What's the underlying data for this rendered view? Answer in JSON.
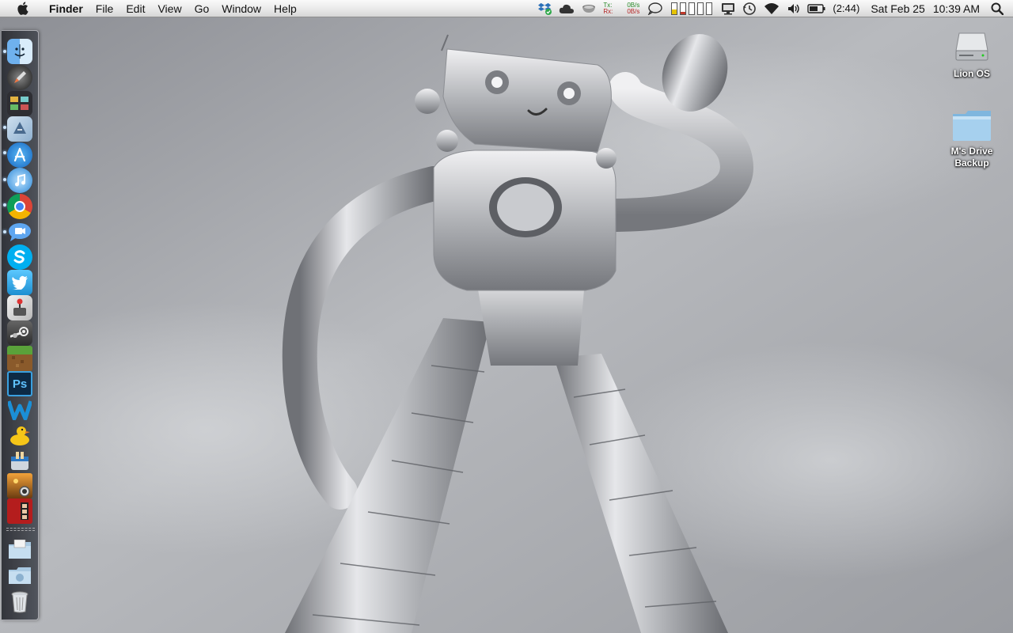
{
  "menubar": {
    "app_name": "Finder",
    "menus": [
      "File",
      "Edit",
      "View",
      "Go",
      "Window",
      "Help"
    ],
    "network": {
      "tx_label": "Tx:",
      "tx_value": "0B/s",
      "rx_label": "Rx:",
      "rx_value": "0B/s"
    },
    "battery_time": "(2:44)",
    "date": "Sat Feb 25",
    "time": "10:39 AM",
    "status_icons": [
      "dropbox-icon",
      "cloud-icon",
      "teacup-icon",
      "network-monitor",
      "speech-bubble-icon",
      "memory-meters",
      "display-icon",
      "time-machine-icon",
      "wifi-icon",
      "volume-icon",
      "battery-icon",
      "spotlight-icon"
    ]
  },
  "desktop": {
    "icons": [
      {
        "label": "Lion OS",
        "icon": "hard-drive-icon"
      },
      {
        "label": "M's Drive Backup",
        "label_line1": "M's Drive",
        "label_line2": "Backup",
        "icon": "folder-icon"
      }
    ]
  },
  "dock": {
    "items": [
      {
        "name": "finder",
        "icon": "finder-icon",
        "running": true
      },
      {
        "name": "launchpad",
        "icon": "launchpad-icon",
        "running": false
      },
      {
        "name": "mission-control",
        "icon": "mission-control-icon",
        "running": false
      },
      {
        "name": "mail",
        "icon": "mail-icon",
        "running": true
      },
      {
        "name": "app-store",
        "icon": "app-store-icon",
        "running": true
      },
      {
        "name": "itunes",
        "icon": "itunes-icon",
        "running": true
      },
      {
        "name": "chrome",
        "icon": "chrome-icon",
        "running": true
      },
      {
        "name": "messages",
        "icon": "messages-icon",
        "running": true
      },
      {
        "name": "skype",
        "icon": "skype-icon",
        "running": false
      },
      {
        "name": "twitter",
        "icon": "twitter-icon",
        "running": false
      },
      {
        "name": "system-preferences-utility",
        "icon": "joystick-icon",
        "running": false
      },
      {
        "name": "steam",
        "icon": "steam-icon",
        "running": false
      },
      {
        "name": "minecraft",
        "icon": "minecraft-icon",
        "running": false
      },
      {
        "name": "photoshop",
        "icon": "photoshop-icon",
        "running": false
      },
      {
        "name": "wordpress",
        "icon": "w-icon",
        "running": false
      },
      {
        "name": "cyberduck",
        "icon": "duck-icon",
        "running": false
      },
      {
        "name": "toast",
        "icon": "toaster-icon",
        "running": false
      },
      {
        "name": "image-capture",
        "icon": "image-capture-icon",
        "running": false
      },
      {
        "name": "photo-booth",
        "icon": "photo-booth-icon",
        "running": false
      },
      {
        "name": "applications-stack",
        "icon": "applications-folder-icon",
        "running": false
      },
      {
        "name": "downloads-stack",
        "icon": "downloads-folder-icon",
        "running": false
      },
      {
        "name": "trash",
        "icon": "trash-icon",
        "running": false
      }
    ],
    "photoshop_label": "Ps"
  },
  "colors": {
    "menubar_top": "#fafafa",
    "menubar_bottom": "#d6d6d6",
    "sky": "#a7a9ae",
    "steel_light": "#e8e8ea",
    "steel_dark": "#7d7f84",
    "folder_blue": "#8ec3e6"
  }
}
